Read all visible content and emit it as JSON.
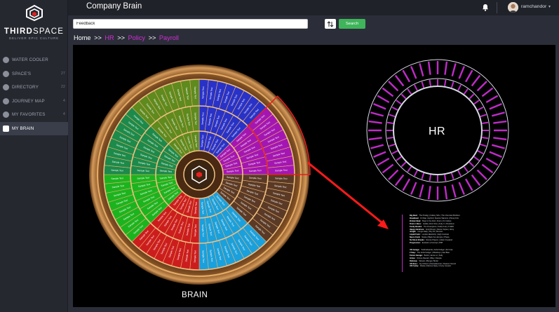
{
  "brand": {
    "name_bold": "THIRD",
    "name_light": "SPACE",
    "tagline": "DELIVER EPIC CULTURE"
  },
  "sidebar": {
    "items": [
      {
        "label": "WATER COOLER",
        "count": "",
        "icon": "coffee-cup-icon",
        "active": false
      },
      {
        "label": "SPACE'S",
        "count": "27",
        "icon": "rocket-icon",
        "active": false
      },
      {
        "label": "DIRECTORY",
        "count": "22",
        "icon": "user-icon",
        "active": false
      },
      {
        "label": "JOURNEY MAP",
        "count": "4",
        "icon": "compass-icon",
        "active": false
      },
      {
        "label": "MY FAVORITES",
        "count": "4",
        "icon": "heart-icon",
        "active": false
      },
      {
        "label": "MY BRAIN",
        "count": "",
        "icon": "brain-icon",
        "active": true
      }
    ]
  },
  "topbar": {
    "title": "Company Brain",
    "user_name": "ramchandor",
    "bell_icon": "bell-icon"
  },
  "search": {
    "value": "Feedback",
    "button_label": "Search",
    "sort_icon": "sort-arrows-icon"
  },
  "breadcrumb": {
    "home": "Home",
    "sep": ">>",
    "path": [
      "HR",
      "Policy",
      "Payroll"
    ]
  },
  "brain": {
    "label": "BRAIN",
    "segment_text": "Sample Text",
    "sector_colors": [
      "#2832c8",
      "#a416b2",
      "#5a3a26",
      "#1aa0dc",
      "#cc1d1d",
      "#1cb41e",
      "#1c8a4a",
      "#5e8a1e"
    ],
    "accent": "#e62020"
  },
  "hr": {
    "label": "HR",
    "ring_color": "#c02bc8"
  },
  "legend": {
    "groups": [
      [
        {
          "key": "Big Beat:",
          "value": "The Prodigy | Fatboy Slim | The Chemical Brothers"
        },
        {
          "key": "Breakbeat:",
          "value": "DJ Rap | Hybrid | Stanton Warriors | Plump DJs"
        },
        {
          "key": "Broken Beat:",
          "value": "Bugz in the Attic | 4hero | IG Culture"
        },
        {
          "key": "Drum n Bass:",
          "value": "Goldie | Roni Size | Andy C | Pendulum"
        },
        {
          "key": "Funky Breaks:",
          "value": "The Freestylers | Krafty Kuts | A Skillz"
        },
        {
          "key": "Happy Hardcore:",
          "value": "Scott Brown | Darren Styles | Hixxy"
        },
        {
          "key": "Jungle:",
          "value": "Congo Natty | Shy FX | Remarc"
        },
        {
          "key": "Liquid Funk:",
          "value": "London Elektricity | High Contrast"
        },
        {
          "key": "Neuro Funk:",
          "value": "Noisia | Black Sun Empire | Phace"
        },
        {
          "key": "Nu Skool Breaks:",
          "value": "Rennie Pilgrem | Adam Freeland"
        },
        {
          "key": "Progressive:",
          "value": "Evolution | Koncept | PMT"
        }
      ],
      [
        {
          "key": "UK Garage:",
          "value": "Todd Edwards | Artful Dodger | MJ Cole"
        },
        {
          "key": "2 Step:",
          "value": "The Artful Dodger | Wideboys | Zed Bias"
        },
        {
          "key": "Future Garage:",
          "value": "Burial | Jamie xx | Sully"
        },
        {
          "key": "Grime:",
          "value": "Dizzee Rascal | Wiley | Skepta"
        },
        {
          "key": "Dubstep:",
          "value": "Skream | Benga | Burial"
        },
        {
          "key": "UK Bass:",
          "value": "Joy Orbison | Ramadanman | Pearson Sound"
        },
        {
          "key": "UK Funky:",
          "value": "Roska | Marcus Nasty | Crazy Cousinz"
        }
      ]
    ]
  }
}
